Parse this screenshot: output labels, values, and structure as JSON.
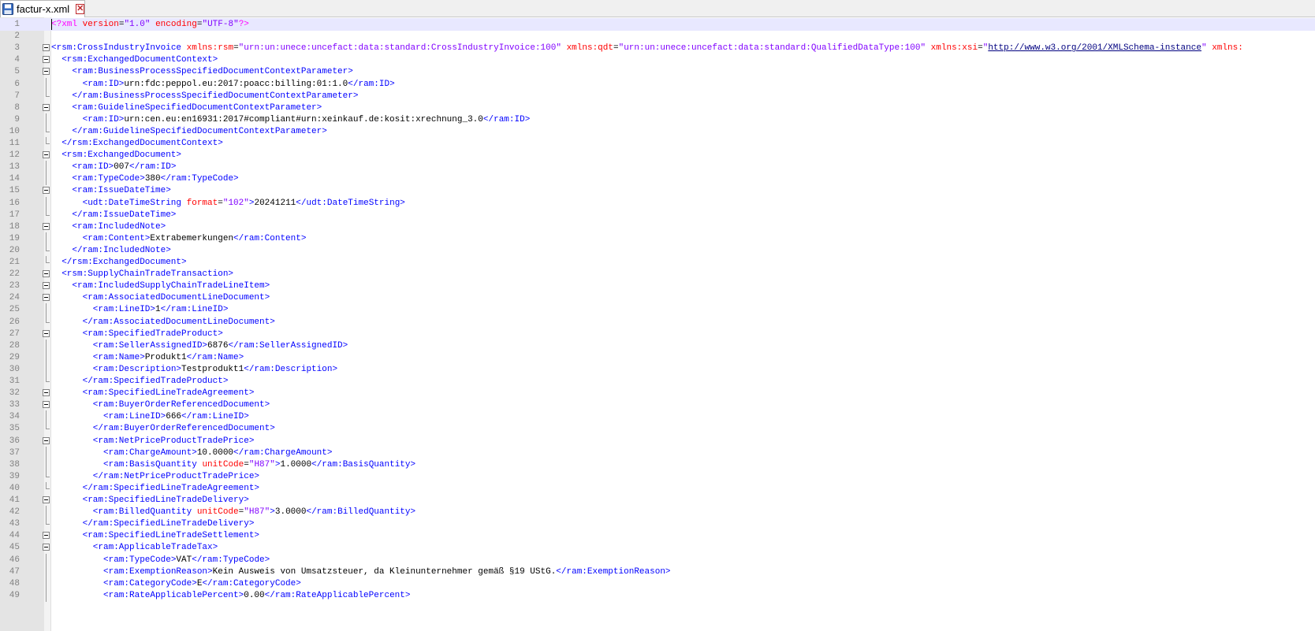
{
  "tab": {
    "title": "factur-x.xml",
    "close_symbol": "✕",
    "icon": "floppy-disk-icon"
  },
  "colors": {
    "tag": "#0000ff",
    "attribute": "#ff0000",
    "value": "#8000ff",
    "link": "#000080",
    "text": "#000000",
    "processing_instruction": "#ff00ff",
    "gutter": "#e4e4e4",
    "current_line": "#e8e8ff"
  },
  "lines": [
    {
      "n": "1",
      "indent": 0,
      "fold": "none",
      "tokens": [
        {
          "c": "pi",
          "t": "<?xml "
        },
        {
          "c": "attr",
          "t": "version"
        },
        {
          "c": "eq",
          "t": "="
        },
        {
          "c": "val",
          "t": "\"1.0\""
        },
        {
          "c": "t",
          "t": " "
        },
        {
          "c": "attr",
          "t": "encoding"
        },
        {
          "c": "eq",
          "t": "="
        },
        {
          "c": "val",
          "t": "\"UTF-8\""
        },
        {
          "c": "pi",
          "t": "?>"
        }
      ]
    },
    {
      "n": "2",
      "indent": 0,
      "fold": "none",
      "tokens": []
    },
    {
      "n": "3",
      "indent": 0,
      "fold": "open",
      "tokens": [
        {
          "c": "tag",
          "t": "<rsm:CrossIndustryInvoice"
        },
        {
          "c": "t",
          "t": " "
        },
        {
          "c": "attr",
          "t": "xmlns:rsm"
        },
        {
          "c": "eq",
          "t": "="
        },
        {
          "c": "val",
          "t": "\"urn:un:unece:uncefact:data:standard:CrossIndustryInvoice:100\""
        },
        {
          "c": "t",
          "t": " "
        },
        {
          "c": "attr",
          "t": "xmlns:qdt"
        },
        {
          "c": "eq",
          "t": "="
        },
        {
          "c": "val",
          "t": "\"urn:un:unece:uncefact:data:standard:QualifiedDataType:100\""
        },
        {
          "c": "t",
          "t": " "
        },
        {
          "c": "attr",
          "t": "xmlns:xsi"
        },
        {
          "c": "eq",
          "t": "="
        },
        {
          "c": "val",
          "t": "\""
        },
        {
          "c": "link",
          "t": "http://www.w3.org/2001/XMLSchema-instance"
        },
        {
          "c": "val",
          "t": "\""
        },
        {
          "c": "t",
          "t": " "
        },
        {
          "c": "attr",
          "t": "xmlns:"
        }
      ]
    },
    {
      "n": "4",
      "indent": 1,
      "fold": "open",
      "tokens": [
        {
          "c": "tag",
          "t": "<rsm:ExchangedDocumentContext>"
        }
      ]
    },
    {
      "n": "5",
      "indent": 2,
      "fold": "open",
      "tokens": [
        {
          "c": "tag",
          "t": "<ram:BusinessProcessSpecifiedDocumentContextParameter>"
        }
      ]
    },
    {
      "n": "6",
      "indent": 3,
      "fold": "line",
      "tokens": [
        {
          "c": "tag",
          "t": "<ram:ID>"
        },
        {
          "c": "t",
          "t": "urn:fdc:peppol.eu:2017:poacc:billing:01:1.0"
        },
        {
          "c": "tag",
          "t": "</ram:ID>"
        }
      ]
    },
    {
      "n": "7",
      "indent": 2,
      "fold": "end",
      "tokens": [
        {
          "c": "tag",
          "t": "</ram:BusinessProcessSpecifiedDocumentContextParameter>"
        }
      ]
    },
    {
      "n": "8",
      "indent": 2,
      "fold": "open",
      "tokens": [
        {
          "c": "tag",
          "t": "<ram:GuidelineSpecifiedDocumentContextParameter>"
        }
      ]
    },
    {
      "n": "9",
      "indent": 3,
      "fold": "line",
      "tokens": [
        {
          "c": "tag",
          "t": "<ram:ID>"
        },
        {
          "c": "t",
          "t": "urn:cen.eu:en16931:2017#compliant#urn:xeinkauf.de:kosit:xrechnung_3.0"
        },
        {
          "c": "tag",
          "t": "</ram:ID>"
        }
      ]
    },
    {
      "n": "10",
      "indent": 2,
      "fold": "end",
      "tokens": [
        {
          "c": "tag",
          "t": "</ram:GuidelineSpecifiedDocumentContextParameter>"
        }
      ]
    },
    {
      "n": "11",
      "indent": 1,
      "fold": "end",
      "tokens": [
        {
          "c": "tag",
          "t": "</rsm:ExchangedDocumentContext>"
        }
      ]
    },
    {
      "n": "12",
      "indent": 1,
      "fold": "open",
      "tokens": [
        {
          "c": "tag",
          "t": "<rsm:ExchangedDocument>"
        }
      ]
    },
    {
      "n": "13",
      "indent": 2,
      "fold": "line",
      "tokens": [
        {
          "c": "tag",
          "t": "<ram:ID>"
        },
        {
          "c": "t",
          "t": "007"
        },
        {
          "c": "tag",
          "t": "</ram:ID>"
        }
      ]
    },
    {
      "n": "14",
      "indent": 2,
      "fold": "line",
      "tokens": [
        {
          "c": "tag",
          "t": "<ram:TypeCode>"
        },
        {
          "c": "t",
          "t": "380"
        },
        {
          "c": "tag",
          "t": "</ram:TypeCode>"
        }
      ]
    },
    {
      "n": "15",
      "indent": 2,
      "fold": "open",
      "tokens": [
        {
          "c": "tag",
          "t": "<ram:IssueDateTime>"
        }
      ]
    },
    {
      "n": "16",
      "indent": 3,
      "fold": "line",
      "tokens": [
        {
          "c": "tag",
          "t": "<udt:DateTimeString"
        },
        {
          "c": "t",
          "t": " "
        },
        {
          "c": "attr",
          "t": "format"
        },
        {
          "c": "eq",
          "t": "="
        },
        {
          "c": "val",
          "t": "\"102\""
        },
        {
          "c": "tag",
          "t": ">"
        },
        {
          "c": "t",
          "t": "20241211"
        },
        {
          "c": "tag",
          "t": "</udt:DateTimeString>"
        }
      ]
    },
    {
      "n": "17",
      "indent": 2,
      "fold": "end",
      "tokens": [
        {
          "c": "tag",
          "t": "</ram:IssueDateTime>"
        }
      ]
    },
    {
      "n": "18",
      "indent": 2,
      "fold": "open",
      "tokens": [
        {
          "c": "tag",
          "t": "<ram:IncludedNote>"
        }
      ]
    },
    {
      "n": "19",
      "indent": 3,
      "fold": "line",
      "tokens": [
        {
          "c": "tag",
          "t": "<ram:Content>"
        },
        {
          "c": "t",
          "t": "Extrabemerkungen"
        },
        {
          "c": "tag",
          "t": "</ram:Content>"
        }
      ]
    },
    {
      "n": "20",
      "indent": 2,
      "fold": "end",
      "tokens": [
        {
          "c": "tag",
          "t": "</ram:IncludedNote>"
        }
      ]
    },
    {
      "n": "21",
      "indent": 1,
      "fold": "end",
      "tokens": [
        {
          "c": "tag",
          "t": "</rsm:ExchangedDocument>"
        }
      ]
    },
    {
      "n": "22",
      "indent": 1,
      "fold": "open",
      "tokens": [
        {
          "c": "tag",
          "t": "<rsm:SupplyChainTradeTransaction>"
        }
      ]
    },
    {
      "n": "23",
      "indent": 2,
      "fold": "open",
      "tokens": [
        {
          "c": "tag",
          "t": "<ram:IncludedSupplyChainTradeLineItem>"
        }
      ]
    },
    {
      "n": "24",
      "indent": 3,
      "fold": "open",
      "tokens": [
        {
          "c": "tag",
          "t": "<ram:AssociatedDocumentLineDocument>"
        }
      ]
    },
    {
      "n": "25",
      "indent": 4,
      "fold": "line",
      "tokens": [
        {
          "c": "tag",
          "t": "<ram:LineID>"
        },
        {
          "c": "t",
          "t": "1"
        },
        {
          "c": "tag",
          "t": "</ram:LineID>"
        }
      ]
    },
    {
      "n": "26",
      "indent": 3,
      "fold": "end",
      "tokens": [
        {
          "c": "tag",
          "t": "</ram:AssociatedDocumentLineDocument>"
        }
      ]
    },
    {
      "n": "27",
      "indent": 3,
      "fold": "open",
      "tokens": [
        {
          "c": "tag",
          "t": "<ram:SpecifiedTradeProduct>"
        }
      ]
    },
    {
      "n": "28",
      "indent": 4,
      "fold": "line",
      "tokens": [
        {
          "c": "tag",
          "t": "<ram:SellerAssignedID>"
        },
        {
          "c": "t",
          "t": "6876"
        },
        {
          "c": "tag",
          "t": "</ram:SellerAssignedID>"
        }
      ]
    },
    {
      "n": "29",
      "indent": 4,
      "fold": "line",
      "tokens": [
        {
          "c": "tag",
          "t": "<ram:Name>"
        },
        {
          "c": "t",
          "t": "Produkt1"
        },
        {
          "c": "tag",
          "t": "</ram:Name>"
        }
      ]
    },
    {
      "n": "30",
      "indent": 4,
      "fold": "line",
      "tokens": [
        {
          "c": "tag",
          "t": "<ram:Description>"
        },
        {
          "c": "t",
          "t": "Testprodukt1"
        },
        {
          "c": "tag",
          "t": "</ram:Description>"
        }
      ]
    },
    {
      "n": "31",
      "indent": 3,
      "fold": "end",
      "tokens": [
        {
          "c": "tag",
          "t": "</ram:SpecifiedTradeProduct>"
        }
      ]
    },
    {
      "n": "32",
      "indent": 3,
      "fold": "open",
      "tokens": [
        {
          "c": "tag",
          "t": "<ram:SpecifiedLineTradeAgreement>"
        }
      ]
    },
    {
      "n": "33",
      "indent": 4,
      "fold": "open",
      "tokens": [
        {
          "c": "tag",
          "t": "<ram:BuyerOrderReferencedDocument>"
        }
      ]
    },
    {
      "n": "34",
      "indent": 5,
      "fold": "line",
      "tokens": [
        {
          "c": "tag",
          "t": "<ram:LineID>"
        },
        {
          "c": "t",
          "t": "666"
        },
        {
          "c": "tag",
          "t": "</ram:LineID>"
        }
      ]
    },
    {
      "n": "35",
      "indent": 4,
      "fold": "end",
      "tokens": [
        {
          "c": "tag",
          "t": "</ram:BuyerOrderReferencedDocument>"
        }
      ]
    },
    {
      "n": "36",
      "indent": 4,
      "fold": "open",
      "tokens": [
        {
          "c": "tag",
          "t": "<ram:NetPriceProductTradePrice>"
        }
      ]
    },
    {
      "n": "37",
      "indent": 5,
      "fold": "line",
      "tokens": [
        {
          "c": "tag",
          "t": "<ram:ChargeAmount>"
        },
        {
          "c": "t",
          "t": "10.0000"
        },
        {
          "c": "tag",
          "t": "</ram:ChargeAmount>"
        }
      ]
    },
    {
      "n": "38",
      "indent": 5,
      "fold": "line",
      "tokens": [
        {
          "c": "tag",
          "t": "<ram:BasisQuantity"
        },
        {
          "c": "t",
          "t": " "
        },
        {
          "c": "attr",
          "t": "unitCode"
        },
        {
          "c": "eq",
          "t": "="
        },
        {
          "c": "val",
          "t": "\"H87\""
        },
        {
          "c": "tag",
          "t": ">"
        },
        {
          "c": "t",
          "t": "1.0000"
        },
        {
          "c": "tag",
          "t": "</ram:BasisQuantity>"
        }
      ]
    },
    {
      "n": "39",
      "indent": 4,
      "fold": "end",
      "tokens": [
        {
          "c": "tag",
          "t": "</ram:NetPriceProductTradePrice>"
        }
      ]
    },
    {
      "n": "40",
      "indent": 3,
      "fold": "end",
      "tokens": [
        {
          "c": "tag",
          "t": "</ram:SpecifiedLineTradeAgreement>"
        }
      ]
    },
    {
      "n": "41",
      "indent": 3,
      "fold": "open",
      "tokens": [
        {
          "c": "tag",
          "t": "<ram:SpecifiedLineTradeDelivery>"
        }
      ]
    },
    {
      "n": "42",
      "indent": 4,
      "fold": "line",
      "tokens": [
        {
          "c": "tag",
          "t": "<ram:BilledQuantity"
        },
        {
          "c": "t",
          "t": " "
        },
        {
          "c": "attr",
          "t": "unitCode"
        },
        {
          "c": "eq",
          "t": "="
        },
        {
          "c": "val",
          "t": "\"H87\""
        },
        {
          "c": "tag",
          "t": ">"
        },
        {
          "c": "t",
          "t": "3.0000"
        },
        {
          "c": "tag",
          "t": "</ram:BilledQuantity>"
        }
      ]
    },
    {
      "n": "43",
      "indent": 3,
      "fold": "end",
      "tokens": [
        {
          "c": "tag",
          "t": "</ram:SpecifiedLineTradeDelivery>"
        }
      ]
    },
    {
      "n": "44",
      "indent": 3,
      "fold": "open",
      "tokens": [
        {
          "c": "tag",
          "t": "<ram:SpecifiedLineTradeSettlement>"
        }
      ]
    },
    {
      "n": "45",
      "indent": 4,
      "fold": "open",
      "tokens": [
        {
          "c": "tag",
          "t": "<ram:ApplicableTradeTax>"
        }
      ]
    },
    {
      "n": "46",
      "indent": 5,
      "fold": "line",
      "tokens": [
        {
          "c": "tag",
          "t": "<ram:TypeCode>"
        },
        {
          "c": "t",
          "t": "VAT"
        },
        {
          "c": "tag",
          "t": "</ram:TypeCode>"
        }
      ]
    },
    {
      "n": "47",
      "indent": 5,
      "fold": "line",
      "tokens": [
        {
          "c": "tag",
          "t": "<ram:ExemptionReason>"
        },
        {
          "c": "t",
          "t": "Kein Ausweis von Umsatzsteuer, da Kleinunternehmer gemäß §19 UStG."
        },
        {
          "c": "tag",
          "t": "</ram:ExemptionReason>"
        }
      ]
    },
    {
      "n": "48",
      "indent": 5,
      "fold": "line",
      "tokens": [
        {
          "c": "tag",
          "t": "<ram:CategoryCode>"
        },
        {
          "c": "t",
          "t": "E"
        },
        {
          "c": "tag",
          "t": "</ram:CategoryCode>"
        }
      ]
    },
    {
      "n": "49",
      "indent": 5,
      "fold": "line",
      "tokens": [
        {
          "c": "tag",
          "t": "<ram:RateApplicablePercent>"
        },
        {
          "c": "t",
          "t": "0.00"
        },
        {
          "c": "tag",
          "t": "</ram:RateApplicablePercent>"
        }
      ]
    }
  ]
}
